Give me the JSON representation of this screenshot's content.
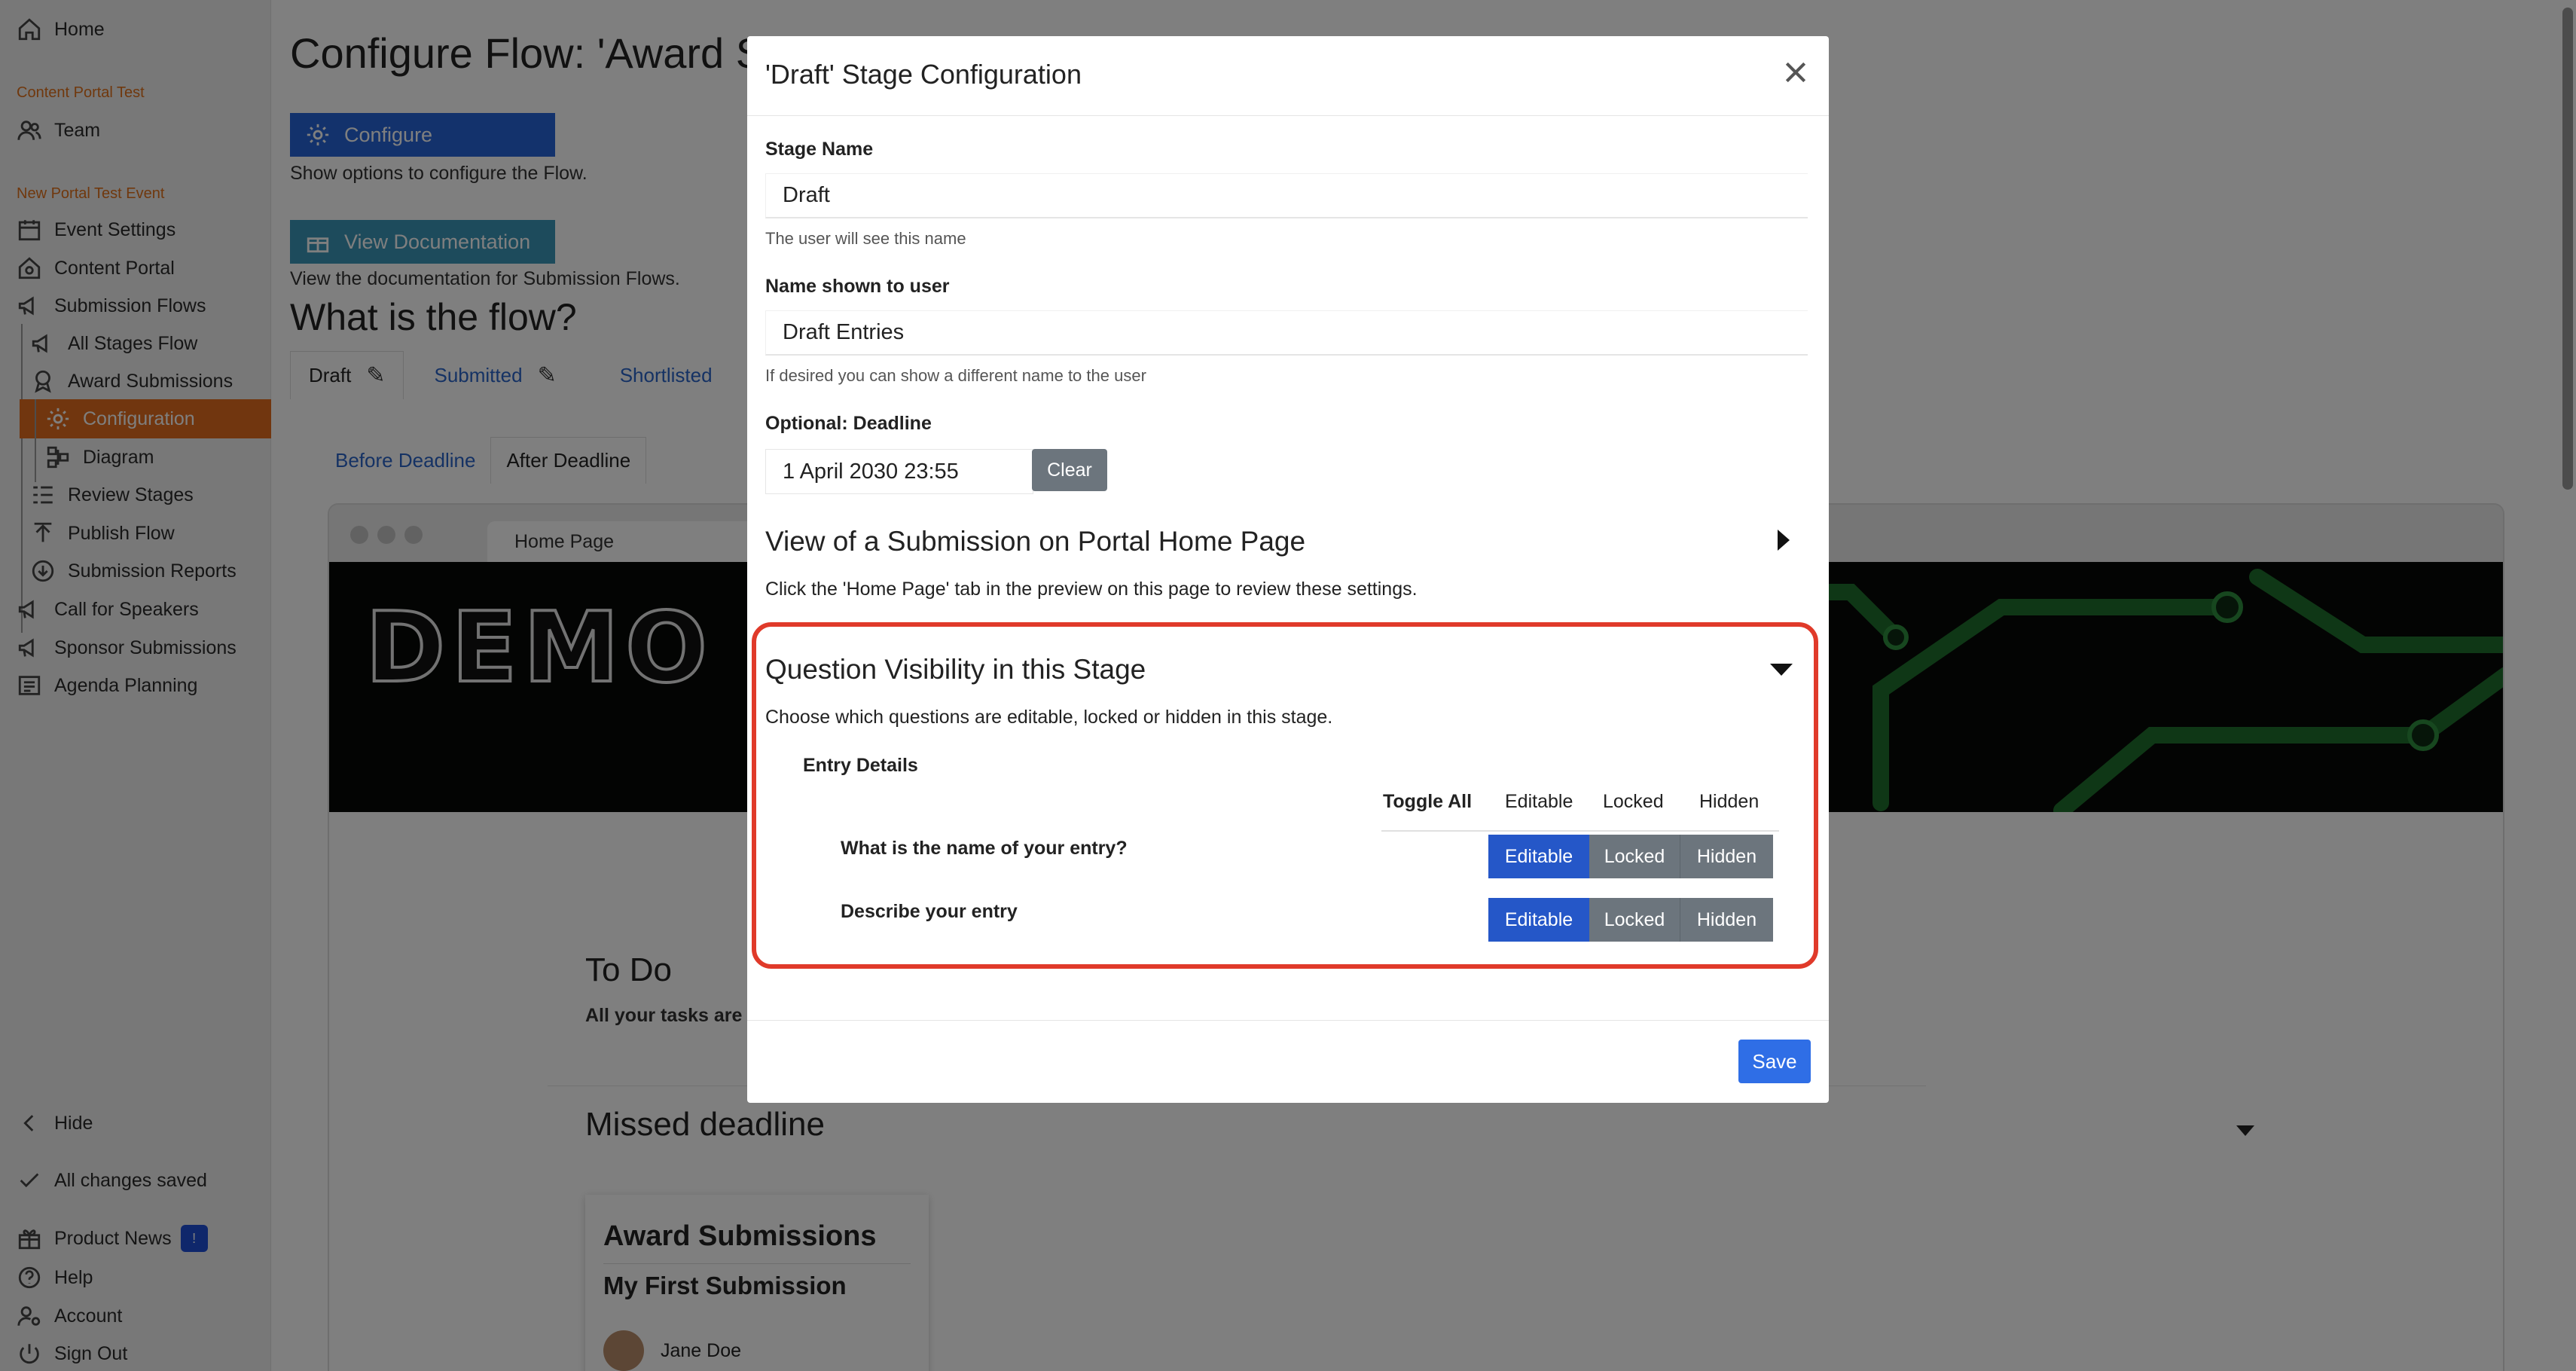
{
  "sidebar": {
    "home": "Home",
    "section1": "Content Portal Test",
    "team": "Team",
    "section2": "New Portal Test Event",
    "items": [
      "Event Settings",
      "Content Portal",
      "Submission Flows",
      "All Stages Flow",
      "Award Submissions",
      "Configuration",
      "Diagram",
      "Review Stages",
      "Publish Flow",
      "Submission Reports",
      "Call for Speakers",
      "Sponsor Submissions",
      "Agenda Planning"
    ],
    "hide": "Hide",
    "saved": "All changes saved",
    "product_news": "Product News",
    "news_badge": "!",
    "help": "Help",
    "account": "Account",
    "sign_out": "Sign Out"
  },
  "main": {
    "title": "Configure Flow: 'Award S",
    "configure_btn": "Configure",
    "configure_help": "Show options to configure the Flow.",
    "docs_btn": "View Documentation",
    "docs_help": "View the documentation for Submission Flows.",
    "flow_heading": "What is the flow?",
    "flow_tabs": [
      "Draft",
      "Submitted",
      "Shortlisted"
    ],
    "sub_tabs": [
      "Before Deadline",
      "After Deadline"
    ],
    "preview_tab": "Home Page",
    "banner_text": "DEMO TE",
    "todo": "To Do",
    "todo_sub": "All your tasks are",
    "missed": "Missed deadline",
    "card_title": "Award Submissions",
    "card_sub": "My First Submission",
    "card_person": "Jane Doe"
  },
  "modal": {
    "title": "'Draft' Stage Configuration",
    "stage_name_label": "Stage Name",
    "stage_name_value": "Draft",
    "stage_name_hint": "The user will see this name",
    "user_name_label": "Name shown to user",
    "user_name_value": "Draft Entries",
    "user_name_hint": "If desired you can show a different name to the user",
    "deadline_label": "Optional: Deadline",
    "deadline_value": "1 April 2030 23:55",
    "clear_btn": "Clear",
    "view_title": "View of a Submission on Portal Home Page",
    "view_desc": "Click the 'Home Page' tab in the preview on this page to review these settings.",
    "visibility_title": "Question Visibility in this Stage",
    "visibility_desc": "Choose which questions are editable, locked or hidden in this stage.",
    "group_label": "Entry Details",
    "columns": {
      "toggle_all": "Toggle All",
      "editable": "Editable",
      "locked": "Locked",
      "hidden": "Hidden"
    },
    "questions": [
      {
        "label": "What is the name of your entry?",
        "editable": "Editable",
        "locked": "Locked",
        "hidden": "Hidden"
      },
      {
        "label": "Describe your entry",
        "editable": "Editable",
        "locked": "Locked",
        "hidden": "Hidden"
      }
    ],
    "save_btn": "Save"
  },
  "colors": {
    "accent_orange": "#e26d1e",
    "primary_blue": "#2764d8",
    "highlight_red": "#e03a2a",
    "teal": "#3a97b8"
  }
}
